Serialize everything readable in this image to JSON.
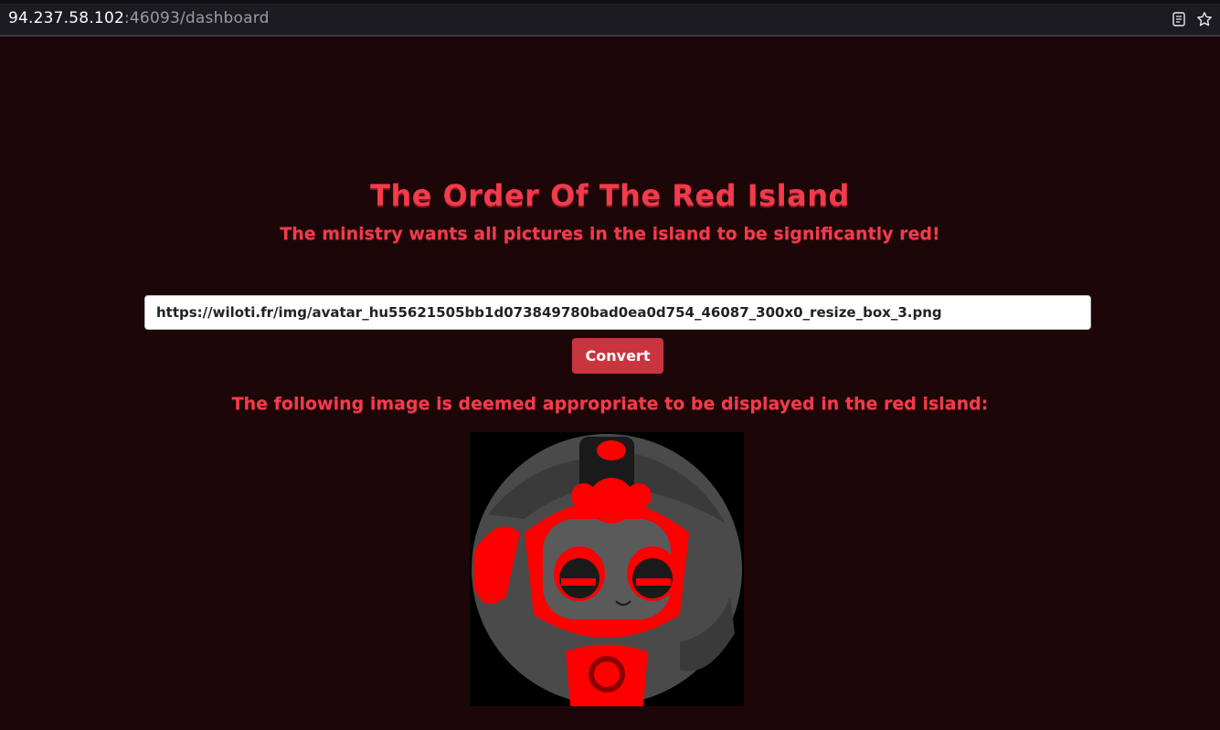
{
  "browser": {
    "url_host": "94.237.58.102",
    "url_rest": ":46093/dashboard",
    "icons": [
      "reader-mode-icon",
      "bookmark-star-icon"
    ]
  },
  "page": {
    "title": "The Order Of The Red Island",
    "subtitle": "The ministry wants all pictures in the island to be significantly red!",
    "url_input_value": "https://wiloti.fr/img/avatar_hu55621505bb1d073849780bad0ea0d754_46087_300x0_resize_box_3.png",
    "convert_label": "Convert",
    "result_caption": "The following image is deemed appropriate to be displayed in the red island:"
  },
  "colors": {
    "background": "#1d0608",
    "accent_red": "#f23b4b",
    "button_red": "#c9353f"
  }
}
